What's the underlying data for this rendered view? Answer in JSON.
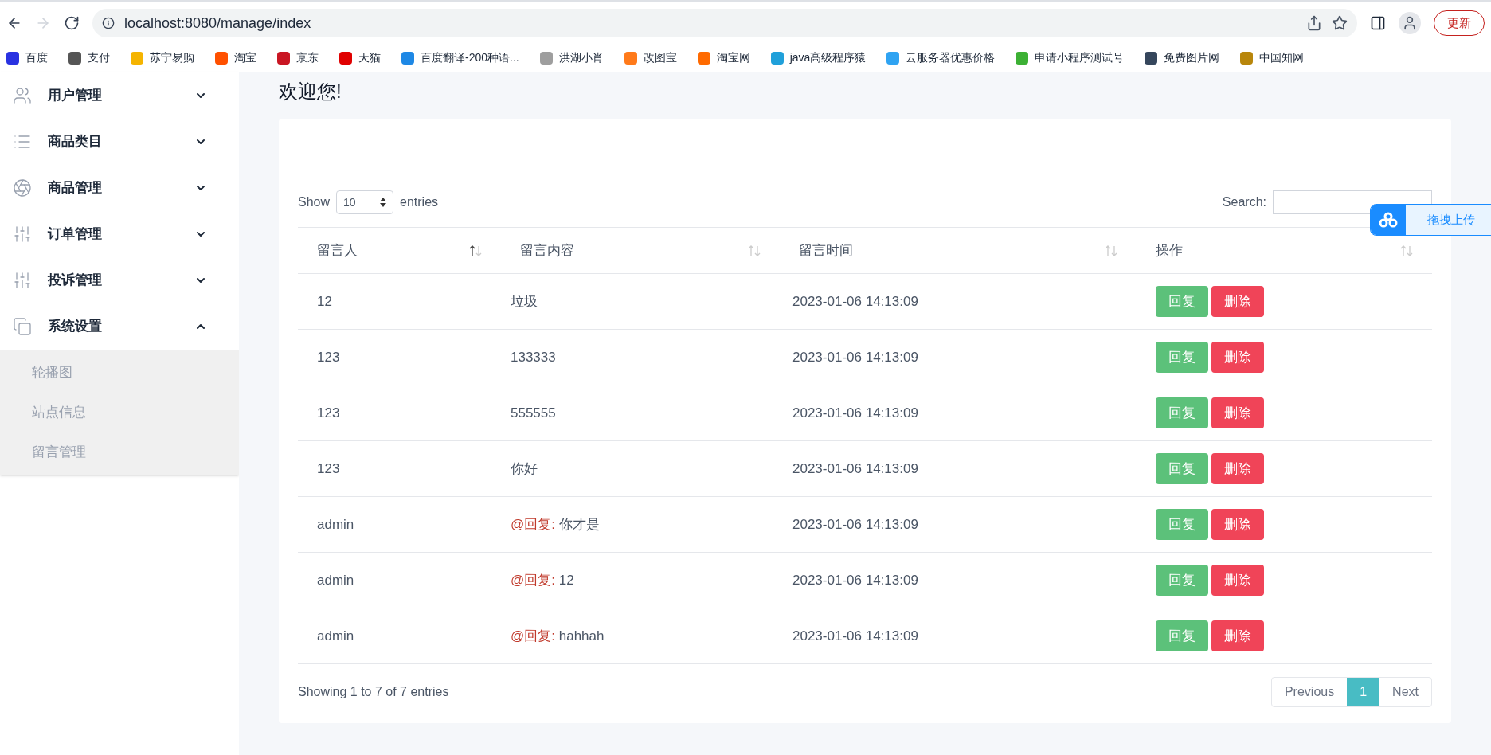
{
  "browser": {
    "url": "localhost:8080/manage/index",
    "update_button": "更新"
  },
  "bookmarks": [
    {
      "label": "百度",
      "color": "#2932e1"
    },
    {
      "label": "支付",
      "color": "#555555"
    },
    {
      "label": "苏宁易购",
      "color": "#f5b400"
    },
    {
      "label": "淘宝",
      "color": "#ff5000"
    },
    {
      "label": "京东",
      "color": "#c91623"
    },
    {
      "label": "天猫",
      "color": "#e00000"
    },
    {
      "label": "百度翻译-200种语...",
      "color": "#1e88e5"
    },
    {
      "label": "洪湖小肖",
      "color": "#9e9e9e"
    },
    {
      "label": "改图宝",
      "color": "#ff7a1a"
    },
    {
      "label": "淘宝网",
      "color": "#ff6a00"
    },
    {
      "label": "java高级程序猿",
      "color": "#20a0da"
    },
    {
      "label": "云服务器优惠价格",
      "color": "#2fa3f2"
    },
    {
      "label": "申请小程序测试号",
      "color": "#3cb034"
    },
    {
      "label": "免费图片网",
      "color": "#35465c"
    },
    {
      "label": "中国知网",
      "color": "#b8860b"
    }
  ],
  "sidebar": {
    "items": [
      {
        "label": "用户管理",
        "kind": "users",
        "expanded": false
      },
      {
        "label": "商品类目",
        "kind": "list",
        "expanded": false
      },
      {
        "label": "商品管理",
        "kind": "aperture",
        "expanded": false
      },
      {
        "label": "订单管理",
        "kind": "sliders",
        "expanded": false
      },
      {
        "label": "投诉管理",
        "kind": "sliders",
        "expanded": false
      },
      {
        "label": "系统设置",
        "kind": "copy",
        "expanded": true,
        "children": [
          {
            "label": "轮播图"
          },
          {
            "label": "站点信息"
          },
          {
            "label": "留言管理"
          }
        ]
      }
    ]
  },
  "page_title": "欢迎您!",
  "table": {
    "show_label": "Show",
    "page_size": "10",
    "entries_label": "entries",
    "search_label": "Search:",
    "columns": [
      {
        "label": "留言人",
        "sorted": true
      },
      {
        "label": "留言内容",
        "sorted": false
      },
      {
        "label": "留言时间",
        "sorted": false
      },
      {
        "label": "操作",
        "sorted": false
      }
    ],
    "rows": [
      {
        "author": "12",
        "content": {
          "kind": "plain",
          "text": "垃圾"
        },
        "time": "2023-01-06 14:13:09",
        "actions": [
          "回复",
          "删除"
        ]
      },
      {
        "author": "123",
        "content": {
          "kind": "plain",
          "text": "133333"
        },
        "time": "2023-01-06 14:13:09",
        "actions": [
          "回复",
          "删除"
        ]
      },
      {
        "author": "123",
        "content": {
          "kind": "plain",
          "text": "555555"
        },
        "time": "2023-01-06 14:13:09",
        "actions": [
          "回复",
          "删除"
        ]
      },
      {
        "author": "123",
        "content": {
          "kind": "plain",
          "text": "你好"
        },
        "time": "2023-01-06 14:13:09",
        "actions": [
          "回复",
          "删除"
        ]
      },
      {
        "author": "admin",
        "content": {
          "kind": "reply",
          "prefix": "@回复:",
          "text": "你才是"
        },
        "time": "2023-01-06 14:13:09",
        "actions": [
          "回复",
          "删除"
        ]
      },
      {
        "author": "admin",
        "content": {
          "kind": "reply",
          "prefix": "@回复:",
          "text": "12"
        },
        "time": "2023-01-06 14:13:09",
        "actions": [
          "回复",
          "删除"
        ]
      },
      {
        "author": "admin",
        "content": {
          "kind": "reply",
          "prefix": "@回复:",
          "text": "hahhah"
        },
        "time": "2023-01-06 14:13:09",
        "actions": [
          "回复",
          "删除"
        ]
      }
    ],
    "info": "Showing 1 to 7 of 7 entries",
    "pagination": [
      {
        "label": "Previous",
        "selected": false
      },
      {
        "label": "1",
        "selected": true
      },
      {
        "label": "Next",
        "selected": false
      }
    ]
  },
  "upload_widget": {
    "label": "拖拽上传"
  }
}
